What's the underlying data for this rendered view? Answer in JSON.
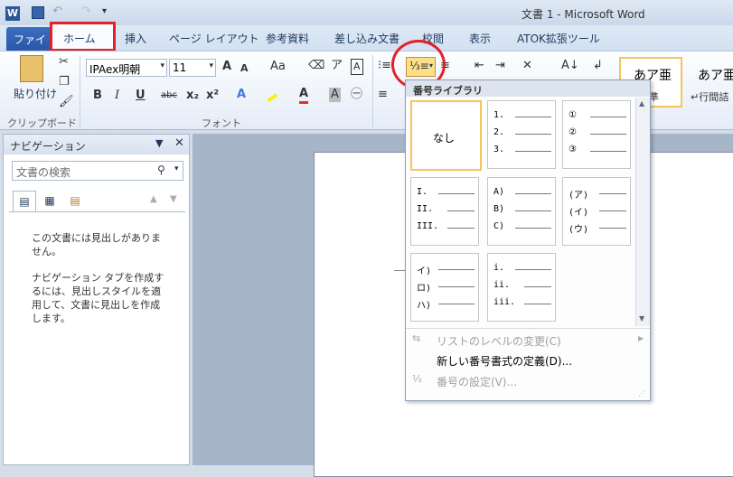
{
  "window": {
    "title": "文書 1 - Microsoft Word"
  },
  "tabs": [
    "ファイル",
    "ホーム",
    "挿入",
    "ページ レイアウト",
    "参考資料",
    "差し込み文書",
    "校閲",
    "表示",
    "ATOK拡張ツール"
  ],
  "ribbon": {
    "clipboard": {
      "paste": "貼り付け",
      "group": "クリップボード"
    },
    "font": {
      "name": "IPAex明朝",
      "size": "11",
      "group": "フォント",
      "bold": "B",
      "italic": "I",
      "underline": "U",
      "strike": "abc",
      "sub": "x₂",
      "sup": "x²",
      "grow": "A",
      "shrink": "A",
      "case": "Aa"
    },
    "styles": {
      "style1": "あア亜",
      "style1_label": "標準",
      "style2": "あア亜",
      "style2_label": "↵行間詰"
    }
  },
  "nav": {
    "title": "ナビゲーション",
    "search_placeholder": "文書の検索",
    "message1": "この文書には見出しがありません。",
    "message2": "ナビゲーション タブを作成するには、見出しスタイルを適用して、文書に見出しを作成します。"
  },
  "dropdown": {
    "header": "番号ライブラリ",
    "none": "なし",
    "formats": [
      [
        "1.",
        "2.",
        "3."
      ],
      [
        "①",
        "②",
        "③"
      ],
      [
        "I.",
        "II.",
        "III."
      ],
      [
        "A)",
        "B)",
        "C)"
      ],
      [
        "(ア)",
        "(イ)",
        "(ウ)"
      ],
      [
        "イ)",
        "ロ)",
        "ハ)"
      ],
      [
        "i.",
        "ii.",
        "iii."
      ]
    ],
    "menu": [
      {
        "label": "リストのレベルの変更(C)",
        "enabled": false
      },
      {
        "label": "新しい番号書式の定義(D)...",
        "enabled": true
      },
      {
        "label": "番号の設定(V)...",
        "enabled": false
      }
    ]
  }
}
